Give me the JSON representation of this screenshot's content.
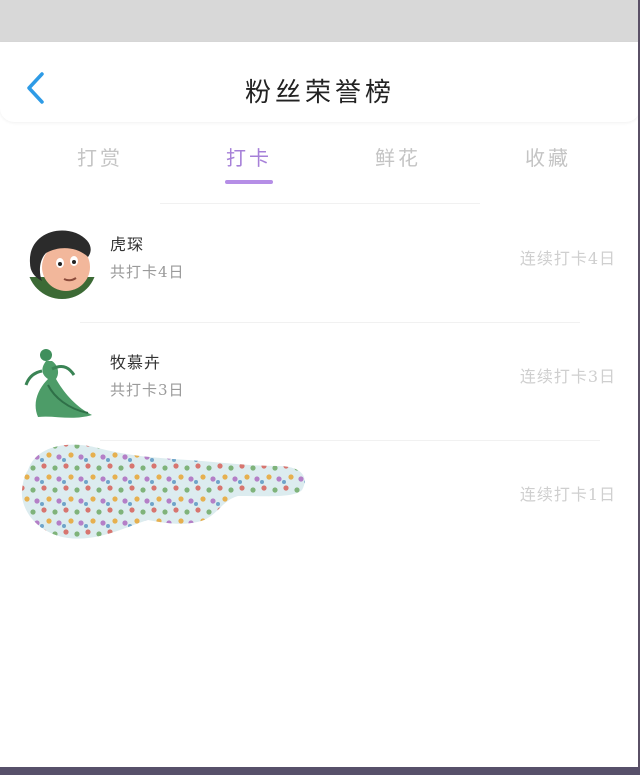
{
  "header": {
    "title": "粉丝荣誉榜",
    "back_icon": "chevron-left-icon"
  },
  "tabs": [
    {
      "label": "打赏",
      "active": false
    },
    {
      "label": "打卡",
      "active": true
    },
    {
      "label": "鲜花",
      "active": false
    },
    {
      "label": "收藏",
      "active": false
    }
  ],
  "colors": {
    "accent": "#a680d8",
    "back": "#2e9be6"
  },
  "rows": [
    {
      "name": "虎琛",
      "total": "共打卡4日",
      "streak": "连续打卡4日",
      "avatar": "cartoon-face-avatar"
    },
    {
      "name": "牧慕卉",
      "total": "共打卡3日",
      "streak": "连续打卡3日",
      "avatar": "green-dancer-avatar"
    },
    {
      "name": "",
      "total": "",
      "streak": "连续打卡1日",
      "avatar": "redacted-dotted-blob"
    }
  ]
}
